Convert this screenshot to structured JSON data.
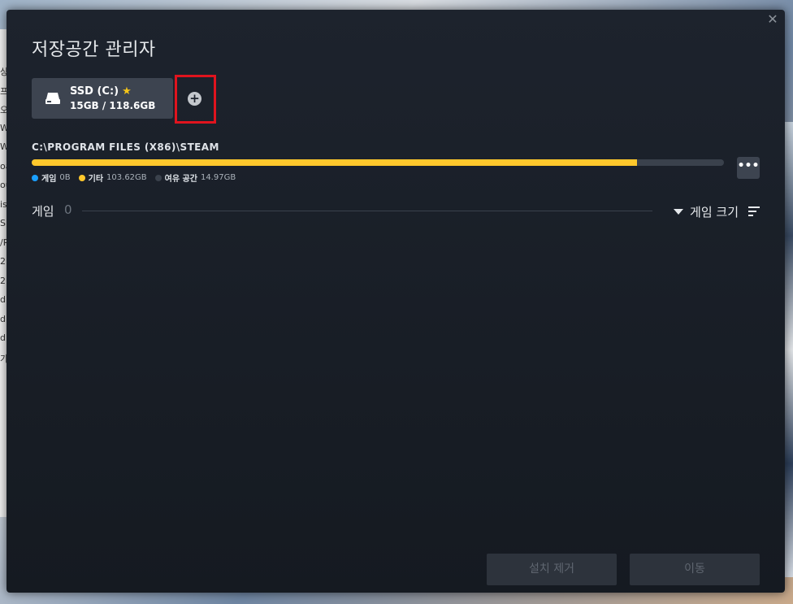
{
  "background": {
    "left_strip_glyphs": [
      "상",
      "프",
      "오",
      "W",
      "W",
      "oa",
      "ou",
      "is",
      "S",
      "/R",
      "2",
      "2",
      "d",
      "d",
      "d",
      "가"
    ]
  },
  "dialog": {
    "title": "저장공간 관리자",
    "close_glyph": "✕"
  },
  "drive": {
    "name": "SSD (C:)",
    "favorite_glyph": "★",
    "size": "15GB / 118.6GB",
    "add_glyph": "+"
  },
  "library": {
    "path": "C:\\PROGRAM FILES (X86)\\STEAM",
    "usage": {
      "games_fraction": 0.0,
      "other_fraction": 0.874,
      "free_fraction": 0.126
    },
    "legend": [
      {
        "label": "게임",
        "value": "0B",
        "color": "#1a9fff"
      },
      {
        "label": "기타",
        "value": "103.62GB",
        "color": "#ffc82c"
      },
      {
        "label": "여유 공간",
        "value": "14.97GB",
        "color": "#3a414c"
      }
    ],
    "more_glyph": "•••"
  },
  "games": {
    "label": "게임",
    "count": "0",
    "sort_label": "게임 크기"
  },
  "actions": {
    "uninstall_label": "설치 제거",
    "move_label": "이동"
  },
  "colors": {
    "accent_yellow": "#ffc82c",
    "accent_blue": "#1a9fff",
    "highlight_red": "#e0141e"
  }
}
